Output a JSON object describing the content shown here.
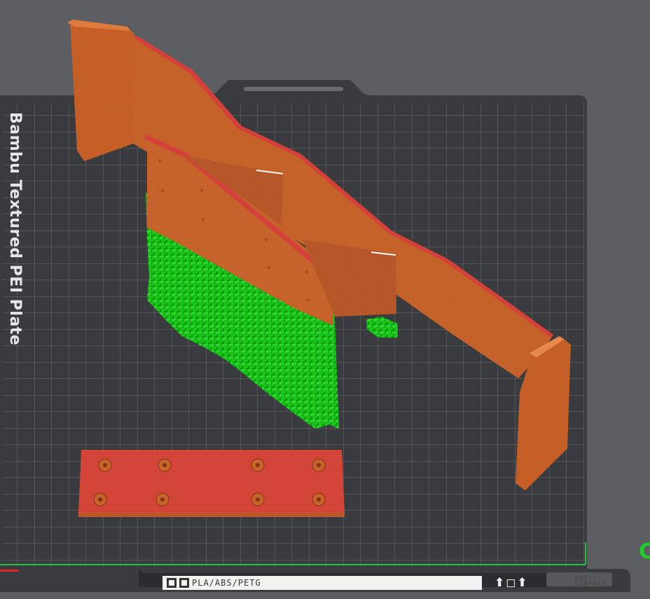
{
  "app": {
    "view": "3D preparation viewport"
  },
  "plate": {
    "label": "Bambu Textured PEI Plate",
    "material_badge": "PLA/ABS/PETG",
    "hot_surface_line1": "HOT",
    "hot_surface_line2": "SURFACE",
    "bottom_symbols": "⬆◻⬆"
  },
  "objects": [
    {
      "name": "rear-wing-part",
      "color": "#c8632a",
      "overhang_color": "#d23a34",
      "support_color": "#18c718"
    },
    {
      "name": "mount-plate",
      "color": "#cf4a38",
      "holes": 8
    }
  ],
  "colors": {
    "background": "#5d5e61",
    "bed": "#3a3b3e",
    "grid": "#6c6e72",
    "axis_x": "#e02424",
    "axis_y": "#20c040"
  }
}
